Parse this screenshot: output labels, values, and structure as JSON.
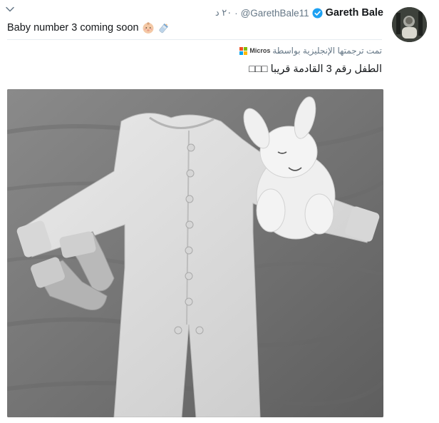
{
  "tweet": {
    "author_name": "Gareth Bale",
    "handle": "@GarethBale11",
    "separator": "·",
    "time": "٢٠ د",
    "text": "Baby number 3 coming soon",
    "emojis": [
      "baby-face-icon",
      "baby-bottle-icon"
    ],
    "translated_by": "تمت ترجمتها الإنجليزية بواسطة",
    "translator_brand": "Micros",
    "translation": "الطفل رقم 3 القادمة قريبا □□□",
    "photo_alt": "",
    "colors": {
      "verified": "#1da1f2",
      "muted_text": "#657786",
      "text": "#14171a"
    }
  }
}
